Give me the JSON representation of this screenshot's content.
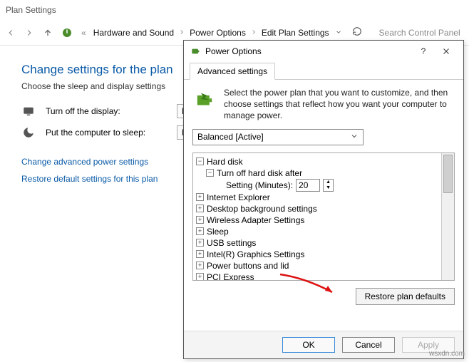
{
  "window": {
    "title": "Plan Settings"
  },
  "breadcrumb": {
    "items": [
      "Hardware and Sound",
      "Power Options",
      "Edit Plan Settings"
    ],
    "search_placeholder": "Search Control Panel"
  },
  "page": {
    "heading": "Change settings for the plan",
    "subheading": "Choose the sleep and display settings",
    "rows": {
      "display_label": "Turn off the display:",
      "display_value": "N",
      "sleep_label": "Put the computer to sleep:",
      "sleep_value": "N"
    },
    "links": {
      "advanced": "Change advanced power settings",
      "restore": "Restore default settings for this plan"
    }
  },
  "dialog": {
    "title": "Power Options",
    "tab": "Advanced settings",
    "intro": "Select the power plan that you want to customize, and then choose settings that reflect how you want your computer to manage power.",
    "plan": "Balanced [Active]",
    "tree": {
      "hard_disk": "Hard disk",
      "turn_off": "Turn off hard disk after",
      "setting_label": "Setting (Minutes):",
      "setting_value": "20",
      "ie": "Internet Explorer",
      "desktop": "Desktop background settings",
      "wireless": "Wireless Adapter Settings",
      "sleep": "Sleep",
      "usb": "USB settings",
      "intel": "Intel(R) Graphics Settings",
      "power_btn": "Power buttons and lid",
      "pci": "PCI Express"
    },
    "restore_btn": "Restore plan defaults",
    "buttons": {
      "ok": "OK",
      "cancel": "Cancel",
      "apply": "Apply"
    }
  },
  "watermark": "wsxdn.com"
}
